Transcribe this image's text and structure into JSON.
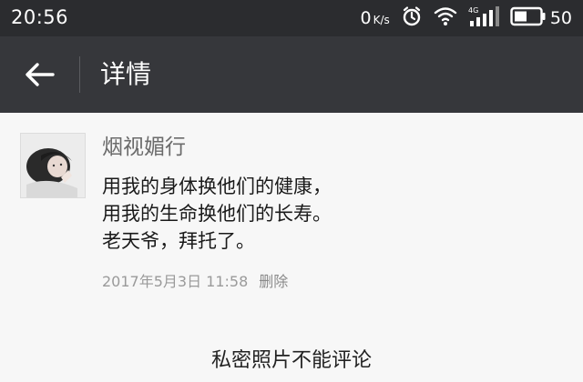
{
  "status_bar": {
    "time": "20:56",
    "net_speed_value": "0",
    "net_speed_unit": "K/s",
    "signal_label": "4G",
    "battery_level": "50"
  },
  "app_bar": {
    "title": "详情",
    "icons": [
      "back-arrow-icon"
    ]
  },
  "post": {
    "author": "烟视媚行",
    "lines": [
      "用我的身体换他们的健康，",
      "用我的生命换他们的长寿。",
      "老天爷，拜托了。"
    ],
    "timestamp": "2017年5月3日 11:58",
    "delete_label": "删除"
  },
  "footer": {
    "private_note": "私密照片不能评论"
  },
  "colors": {
    "status_bar_bg": "#2b2c2f",
    "app_bar_bg": "#36373b",
    "page_bg": "#f7f7f7"
  }
}
